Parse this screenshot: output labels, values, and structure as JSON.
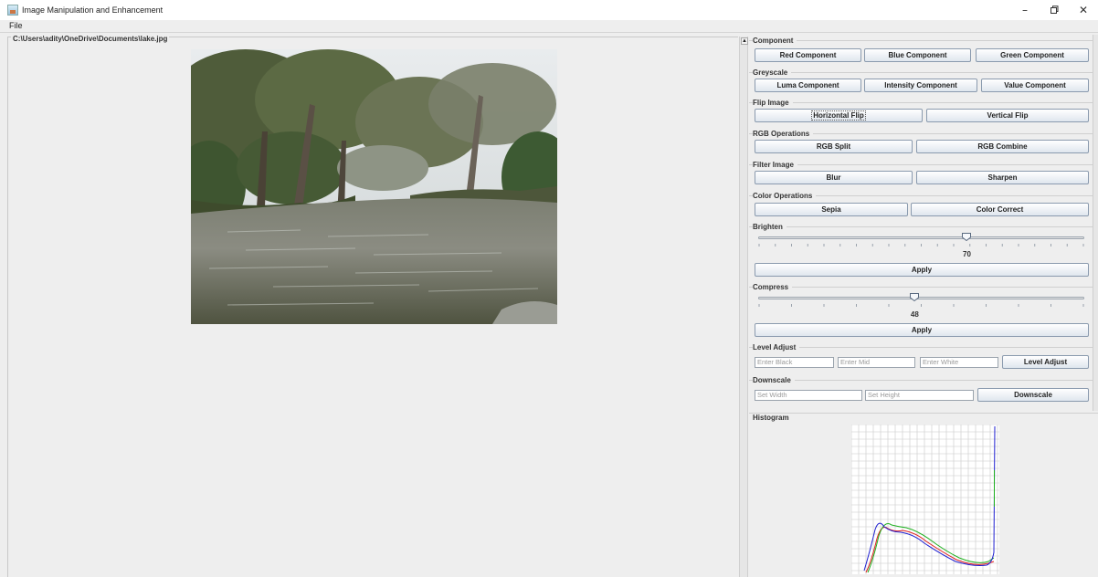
{
  "window": {
    "title": "Image Manipulation and Enhancement",
    "controls": [
      "–",
      "☐",
      "✕"
    ]
  },
  "menu": {
    "file": "File"
  },
  "image_panel": {
    "path": "C:\\Users\\adity\\OneDrive\\Documents\\lake.jpg"
  },
  "groups": {
    "component": {
      "title": "Component",
      "red": "Red Component",
      "blue": "Blue Component",
      "green": "Green Component"
    },
    "greyscale": {
      "title": "Greyscale",
      "luma": "Luma Component",
      "intensity": "Intensity Component",
      "value": "Value Component"
    },
    "flip": {
      "title": "Flip Image",
      "horizontal": "Horizontal Flip",
      "vertical": "Vertical Flip"
    },
    "rgb": {
      "title": "RGB Operations",
      "split": "RGB Split",
      "combine": "RGB Combine"
    },
    "filter": {
      "title": "Filter Image",
      "blur": "Blur",
      "sharpen": "Sharpen"
    },
    "color": {
      "title": "Color Operations",
      "sepia": "Sepia",
      "correct": "Color Correct"
    },
    "brighten": {
      "title": "Brighten",
      "value": "70",
      "level": 0.64,
      "apply": "Apply"
    },
    "compress": {
      "title": "Compress",
      "value": "48",
      "level": 0.48,
      "apply": "Apply"
    },
    "level_adjust": {
      "title": "Level Adjust",
      "black_placeholder": "Enter Black",
      "mid_placeholder": "Enter Mid",
      "white_placeholder": "Enter White",
      "button": "Level Adjust"
    },
    "downscale": {
      "title": "Downscale",
      "width_placeholder": "Set Width",
      "height_placeholder": "Set Height",
      "button": "Downscale"
    }
  },
  "histogram": {
    "title": "Histogram",
    "colors": {
      "red": "#e02020",
      "green": "#20b020",
      "blue": "#2020d0"
    }
  }
}
